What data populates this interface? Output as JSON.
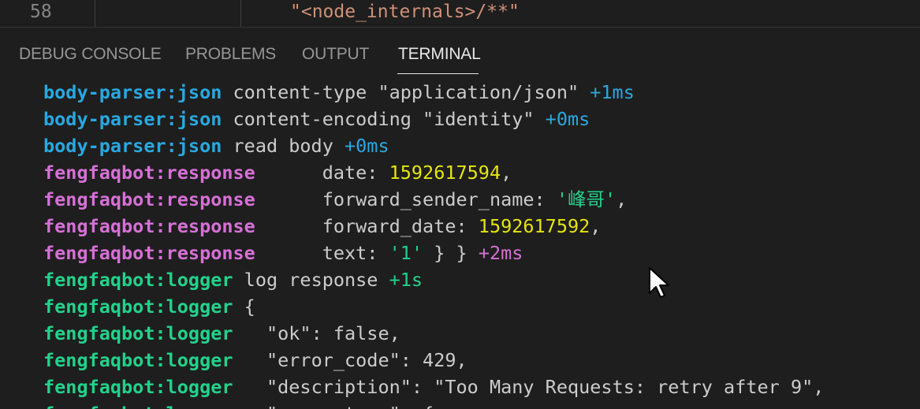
{
  "editor": {
    "line_number": "58",
    "code_text": "\"<node_internals>/**\""
  },
  "panel": {
    "tabs": [
      {
        "label": "DEBUG CONSOLE",
        "active": false
      },
      {
        "label": "PROBLEMS",
        "active": false
      },
      {
        "label": "OUTPUT",
        "active": false
      },
      {
        "label": "TERMINAL",
        "active": true
      }
    ]
  },
  "terminal": {
    "lines": [
      {
        "ns": "body-parser:json",
        "text": " content-type \"application/json\" ",
        "timing": "+1ms"
      },
      {
        "ns": "body-parser:json",
        "text": " content-encoding \"identity\" ",
        "timing": "+0ms"
      },
      {
        "ns": "body-parser:json",
        "text": " read body ",
        "timing": "+0ms"
      },
      {
        "ns": "fengfaqbot:response",
        "text": "      date: ",
        "value": "1592617594",
        "tail": ","
      },
      {
        "ns": "fengfaqbot:response",
        "text": "      forward_sender_name: ",
        "value": "'峰哥'",
        "tail": ","
      },
      {
        "ns": "fengfaqbot:response",
        "text": "      forward_date: ",
        "value": "1592617592",
        "tail": ","
      },
      {
        "ns": "fengfaqbot:response",
        "text": "      text: ",
        "value": "'1'",
        "tail": " } } ",
        "timing": "+2ms"
      },
      {
        "ns": "fengfaqbot:logger",
        "text": " log response ",
        "timing": "+1s"
      },
      {
        "ns": "fengfaqbot:logger",
        "text": " {"
      },
      {
        "ns": "fengfaqbot:logger",
        "text": "   \"ok\": false,"
      },
      {
        "ns": "fengfaqbot:logger",
        "text": "   \"error_code\": 429,"
      },
      {
        "ns": "fengfaqbot:logger",
        "text": "   \"description\": \"Too Many Requests: retry after 9\","
      },
      {
        "ns": "fengfaqbot:logger",
        "text": "   \"parameters\": {"
      }
    ]
  },
  "colors": {
    "background": "#1e1e1e",
    "namespace_body_parser": "#29a8e0",
    "namespace_response": "#d670d6",
    "namespace_logger": "#23d18b",
    "number_value": "#e5e510",
    "string_value": "#23d18b",
    "plain_text": "#cccccc"
  },
  "icons": {
    "mouse_pointer": "arrow-cursor-icon"
  }
}
